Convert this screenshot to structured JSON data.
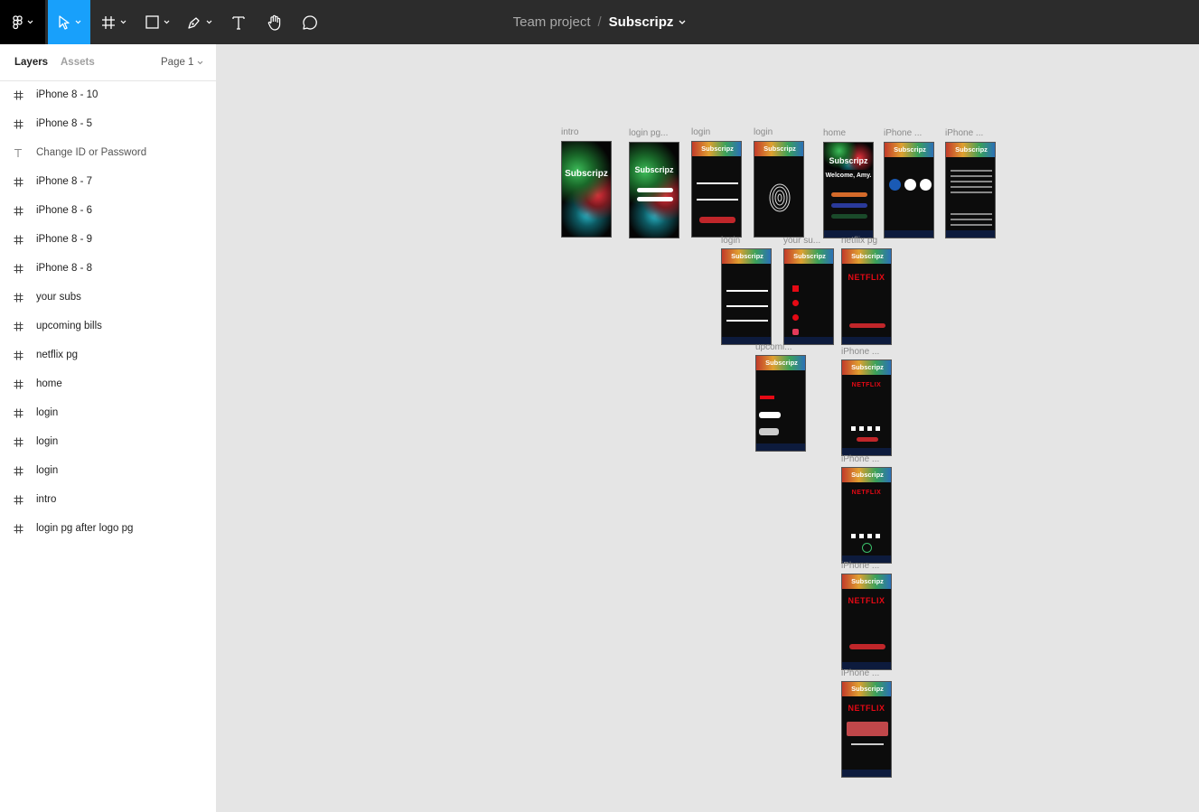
{
  "header": {
    "team": "Team project",
    "separator": "/",
    "project": "Subscripz"
  },
  "toolbar": {
    "tools": [
      "figma-menu",
      "move-tool",
      "frame-tool",
      "shape-tool",
      "pen-tool",
      "text-tool",
      "hand-tool",
      "comment-tool"
    ]
  },
  "sidebar": {
    "tab_layers": "Layers",
    "tab_assets": "Assets",
    "page": "Page 1",
    "layers": [
      {
        "name": "iPhone 8 - 10",
        "type": "frame"
      },
      {
        "name": "iPhone 8 - 5",
        "type": "frame"
      },
      {
        "name": "Change ID or Password",
        "type": "text"
      },
      {
        "name": "iPhone 8 - 7",
        "type": "frame"
      },
      {
        "name": "iPhone 8 - 6",
        "type": "frame"
      },
      {
        "name": "iPhone 8 - 9",
        "type": "frame"
      },
      {
        "name": "iPhone 8 - 8",
        "type": "frame"
      },
      {
        "name": "your subs",
        "type": "frame"
      },
      {
        "name": "upcoming bills",
        "type": "frame"
      },
      {
        "name": "netflix pg",
        "type": "frame"
      },
      {
        "name": "home",
        "type": "frame"
      },
      {
        "name": "login",
        "type": "frame"
      },
      {
        "name": "login",
        "type": "frame"
      },
      {
        "name": "login",
        "type": "frame"
      },
      {
        "name": "intro",
        "type": "frame"
      },
      {
        "name": "login pg after logo pg",
        "type": "frame"
      }
    ]
  },
  "canvas": {
    "frame_labels": {
      "intro": "intro",
      "login_pg": "login pg...",
      "login1": "login",
      "login2": "login",
      "home": "home",
      "iphone_a": "iPhone ...",
      "iphone_b": "iPhone ...",
      "login3": "login",
      "your_subs": "your su...",
      "netflix_pg": "netflix pg",
      "upcoming": "upcomi...",
      "iphone_c": "iPhone ...",
      "iphone_d": "iPhone ...",
      "iphone_e": "iPhone ...",
      "iphone_f": "iPhone ..."
    },
    "app_title": "Subscripz",
    "netflix": "NETFLIX",
    "welcome": "Welcome, Amy.",
    "new_subs": "New Subscriptions:",
    "your_subs": "Your Subscriptions:",
    "upcoming_billing": "Upcoming Billing:",
    "settings": "Settings:",
    "done": "Done"
  }
}
